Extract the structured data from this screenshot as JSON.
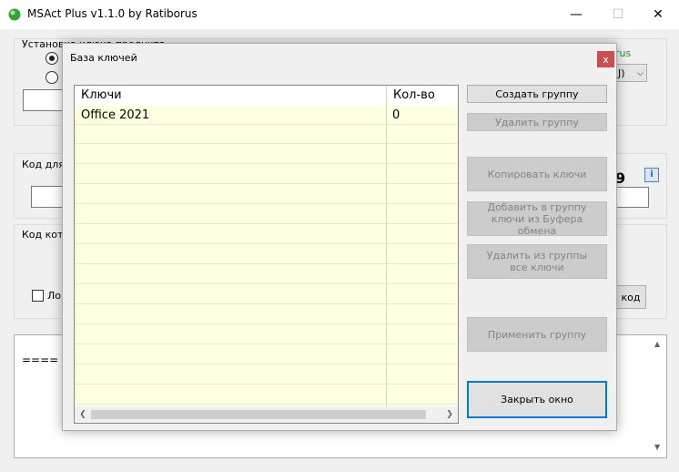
{
  "window": {
    "title": "MSAct Plus v1.1.0 by Ratiborus",
    "minimize": "—",
    "maximize": "☐",
    "close": "✕"
  },
  "background": {
    "group1_label": "Установка ключа продукта",
    "status_green": "rus",
    "dropdown_value": "J)",
    "code_for_label": "Код для",
    "code_which_label": "Код кото",
    "checkbox_label": "Ло",
    "code_button": "код",
    "digit": "9",
    "log_text": "==== I"
  },
  "dialog": {
    "title": "База ключей",
    "close": "x",
    "grid": {
      "columns": [
        "Ключи",
        "Кол-во"
      ],
      "rows": [
        {
          "key": "Office 2021",
          "count": "0"
        }
      ]
    },
    "buttons": {
      "create_group": "Создать группу",
      "delete_group": "Удалить группу",
      "copy_keys": "Копировать ключи",
      "add_from_clipboard": "Добавить в группу ключи из Буфера обмена",
      "delete_all": "Удалить из группы все ключи",
      "apply_group": "Применить группу",
      "close_window": "Закрыть окно"
    }
  },
  "colors": {
    "grid_background": "#ffffe1",
    "close_button": "#c75050",
    "accent_green": "#2e8b2e"
  }
}
